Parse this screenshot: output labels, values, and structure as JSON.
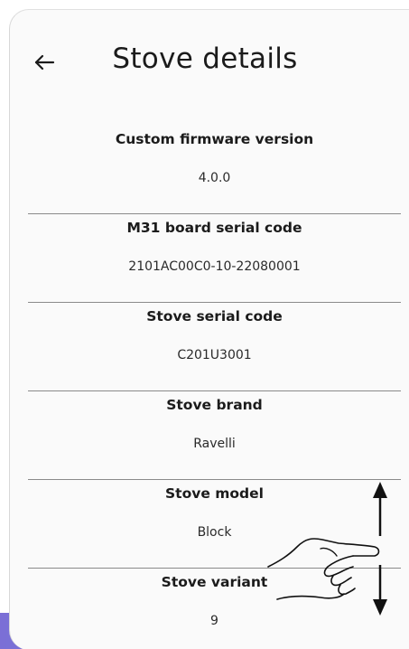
{
  "header": {
    "title": "Stove details",
    "back_icon": "arrow-left-icon"
  },
  "details": [
    {
      "label": "Custom firmware version",
      "value": "4.0.0"
    },
    {
      "label": "M31 board serial code",
      "value": "2101AC00C0-10-22080001"
    },
    {
      "label": "Stove serial code",
      "value": "C201U3001"
    },
    {
      "label": "Stove brand",
      "value": "Ravelli"
    },
    {
      "label": "Stove model",
      "value": "Block"
    },
    {
      "label": "Stove variant",
      "value": "9"
    }
  ],
  "overlay": {
    "icon": "scroll-gesture-hand-icon"
  },
  "colors": {
    "background": "#fafafa",
    "divider": "#8a8a8a",
    "text": "#1b1b1b"
  }
}
